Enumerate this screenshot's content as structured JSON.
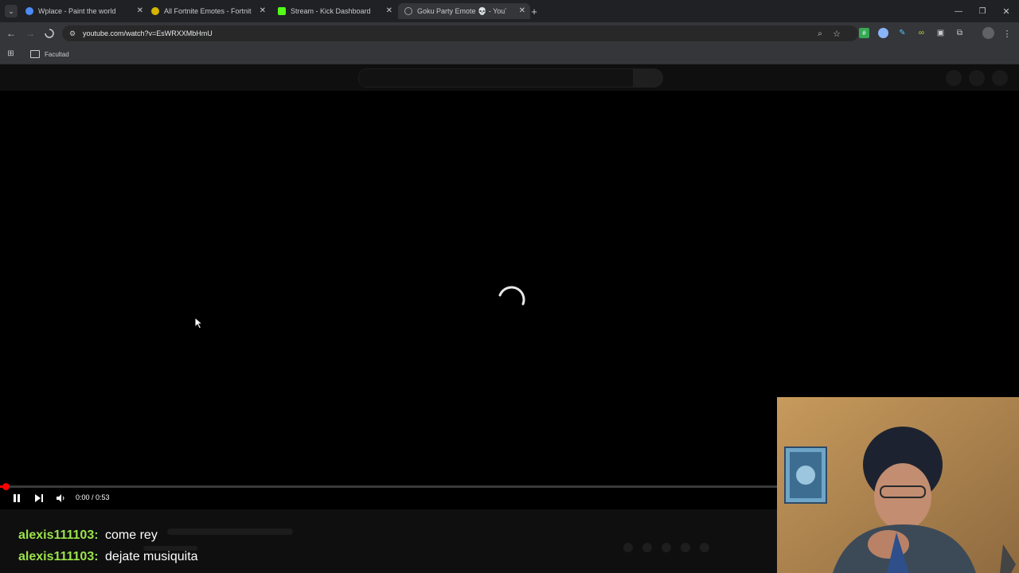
{
  "tabs": [
    {
      "title": "Wplace - Paint the world",
      "favicon": "globe-icon",
      "color": "#4c8bf5"
    },
    {
      "title": "All Fortnite Emotes - Fortnite.G",
      "favicon": "fortnite-icon",
      "color": "#d4b400"
    },
    {
      "title": "Stream - Kick Dashboard",
      "favicon": "kick-icon",
      "color": "#53fc18"
    },
    {
      "title": "Goku Party Emote 💀 - YouTub",
      "favicon": "youtube-loading-icon",
      "color": "#9aa0a6"
    }
  ],
  "address_bar": {
    "url": "youtube.com/watch?v=EsWRXXMbHmU"
  },
  "bookmarks": [
    {
      "label": "Facultad"
    }
  ],
  "player": {
    "time_display": "0:00 / 0:53",
    "progress_fraction": 0.0
  },
  "chat": [
    {
      "user": "alexis111103:",
      "message": "come rey"
    },
    {
      "user": "alexis111103:",
      "message": "dejate musiquita"
    }
  ],
  "colors": {
    "chrome_bg": "#202124",
    "toolbar_bg": "#35363a",
    "youtube_red": "#ff0000",
    "chat_user": "#9be34a"
  }
}
